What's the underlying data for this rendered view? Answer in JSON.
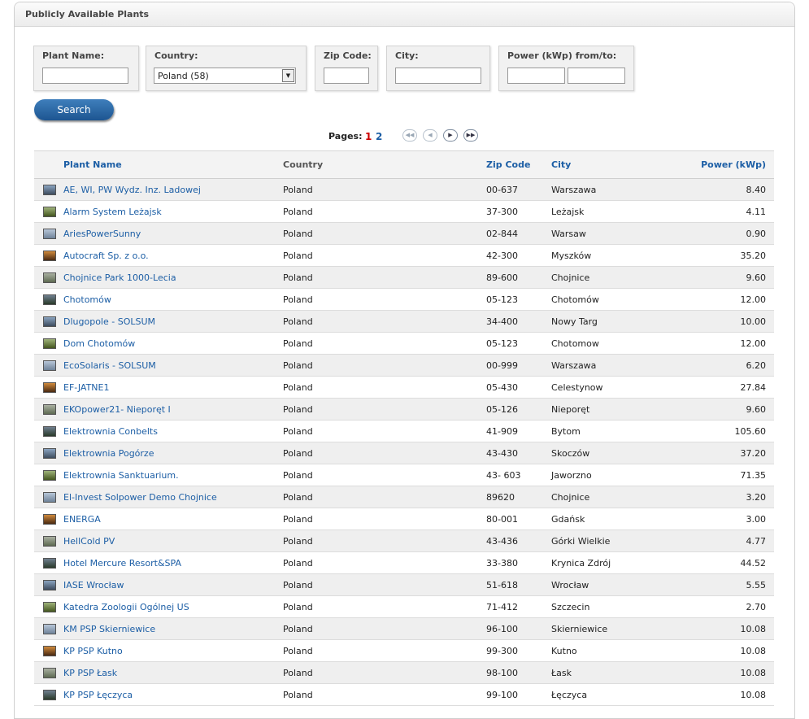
{
  "panel": {
    "title": "Publicly Available Plants"
  },
  "filters": {
    "plant_name": {
      "label": "Plant Name:",
      "value": ""
    },
    "country": {
      "label": "Country:",
      "selected": "Poland (58)"
    },
    "zip": {
      "label": "Zip Code:",
      "value": ""
    },
    "city": {
      "label": "City:",
      "value": ""
    },
    "power": {
      "label": "Power (kWp) from/to:",
      "from": "",
      "to": ""
    }
  },
  "search_label": "Search",
  "pagination": {
    "label": "Pages:",
    "current": "1",
    "other": "2"
  },
  "columns": {
    "name": "Plant Name",
    "country": "Country",
    "zip": "Zip Code",
    "city": "City",
    "power": "Power (kWp)"
  },
  "rows": [
    {
      "name": "AE, WI, PW Wydz. Inz. Ladowej",
      "country": "Poland",
      "zip": "00-637",
      "city": "Warszawa",
      "power": "8.40"
    },
    {
      "name": "Alarm System Leżajsk",
      "country": "Poland",
      "zip": "37-300",
      "city": "Leżajsk",
      "power": "4.11"
    },
    {
      "name": "AriesPowerSunny",
      "country": "Poland",
      "zip": "02-844",
      "city": "Warsaw",
      "power": "0.90"
    },
    {
      "name": "Autocraft Sp. z o.o.",
      "country": "Poland",
      "zip": "42-300",
      "city": "Myszków",
      "power": "35.20"
    },
    {
      "name": "Chojnice Park 1000-Lecia",
      "country": "Poland",
      "zip": "89-600",
      "city": "Chojnice",
      "power": "9.60"
    },
    {
      "name": "Chotomów",
      "country": "Poland",
      "zip": "05-123",
      "city": "Chotomów",
      "power": "12.00"
    },
    {
      "name": "Dlugopole - SOLSUM",
      "country": "Poland",
      "zip": "34-400",
      "city": "Nowy Targ",
      "power": "10.00"
    },
    {
      "name": "Dom Chotomów",
      "country": "Poland",
      "zip": "05-123",
      "city": "Chotomow",
      "power": "12.00"
    },
    {
      "name": "EcoSolaris - SOLSUM",
      "country": "Poland",
      "zip": "00-999",
      "city": "Warszawa",
      "power": "6.20"
    },
    {
      "name": "EF-JATNE1",
      "country": "Poland",
      "zip": "05-430",
      "city": "Celestynow",
      "power": "27.84"
    },
    {
      "name": "EKOpower21- Nieporęt I",
      "country": "Poland",
      "zip": "05-126",
      "city": "Nieporęt",
      "power": "9.60"
    },
    {
      "name": "Elektrownia Conbelts",
      "country": "Poland",
      "zip": "41-909",
      "city": "Bytom",
      "power": "105.60"
    },
    {
      "name": "Elektrownia Pogórze",
      "country": "Poland",
      "zip": "43-430",
      "city": "Skoczów",
      "power": "37.20"
    },
    {
      "name": "Elektrownia Sanktuarium.",
      "country": "Poland",
      "zip": "43- 603",
      "city": "Jaworzno",
      "power": "71.35"
    },
    {
      "name": "El-Invest Solpower Demo Chojnice",
      "country": "Poland",
      "zip": "89620",
      "city": "Chojnice",
      "power": "3.20"
    },
    {
      "name": "ENERGA",
      "country": "Poland",
      "zip": "80-001",
      "city": "Gdańsk",
      "power": "3.00"
    },
    {
      "name": "HellCold PV",
      "country": "Poland",
      "zip": "43-436",
      "city": "Górki Wielkie",
      "power": "4.77"
    },
    {
      "name": "Hotel Mercure Resort&SPA",
      "country": "Poland",
      "zip": "33-380",
      "city": "Krynica Zdrój",
      "power": "44.52"
    },
    {
      "name": "IASE Wrocław",
      "country": "Poland",
      "zip": "51-618",
      "city": "Wrocław",
      "power": "5.55"
    },
    {
      "name": "Katedra Zoologii Ogólnej US",
      "country": "Poland",
      "zip": "71-412",
      "city": "Szczecin",
      "power": "2.70"
    },
    {
      "name": "KM PSP Skierniewice",
      "country": "Poland",
      "zip": "96-100",
      "city": "Skierniewice",
      "power": "10.08"
    },
    {
      "name": "KP PSP Kutno",
      "country": "Poland",
      "zip": "99-300",
      "city": "Kutno",
      "power": "10.08"
    },
    {
      "name": "KP PSP Łask",
      "country": "Poland",
      "zip": "98-100",
      "city": "Łask",
      "power": "10.08"
    },
    {
      "name": "KP PSP Łęczyca",
      "country": "Poland",
      "zip": "99-100",
      "city": "Łęczyca",
      "power": "10.08"
    }
  ]
}
